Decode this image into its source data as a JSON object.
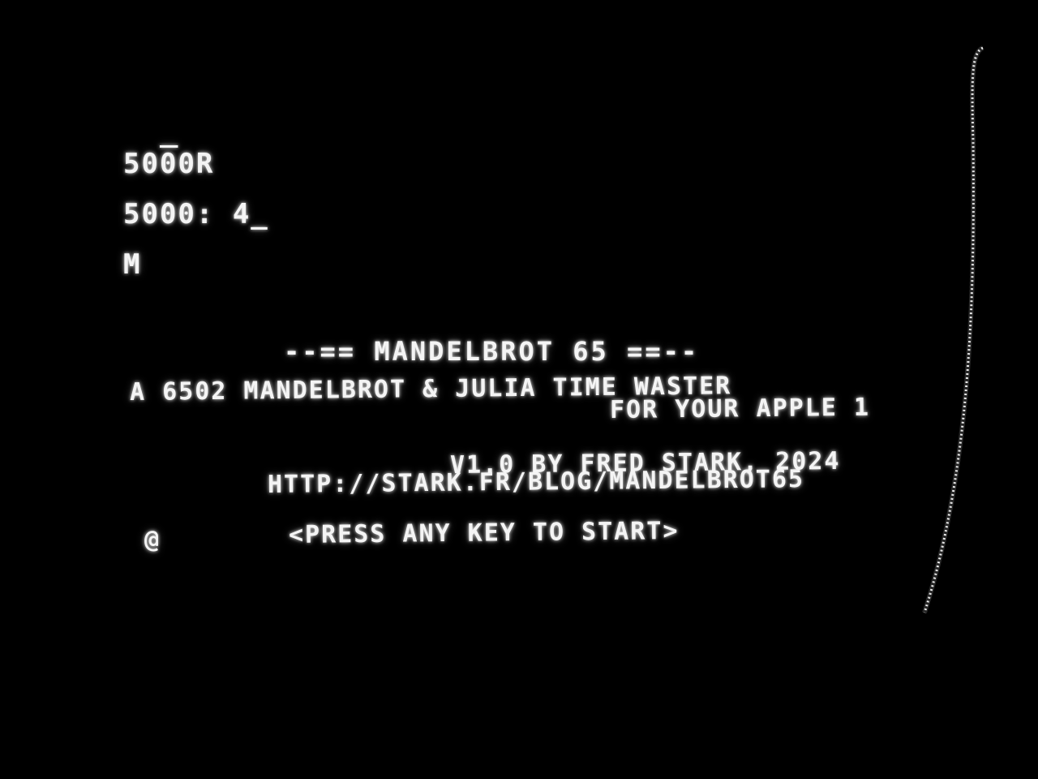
{
  "monitor": {
    "line1_prefix": "50",
    "line1_marked": "0",
    "line1_suffix": "0R",
    "line2": "5000: 4",
    "cursor": "_",
    "line3": "M"
  },
  "splash": {
    "title": "--== MANDELBROT 65 ==--",
    "tagline_1": "A 6502 MANDELBROT & JULIA TIME WASTER",
    "tagline_2": "FOR YOUR APPLE 1",
    "credits": "V1.0 BY FRED STARK, 2024",
    "url": "HTTP://STARK.FR/BLOG/MANDELBROT65",
    "prompt_char": "@",
    "prompt": "<PRESS ANY KEY TO START>"
  },
  "colors": {
    "background": "#000000",
    "phosphor": "#f4f4f4"
  }
}
